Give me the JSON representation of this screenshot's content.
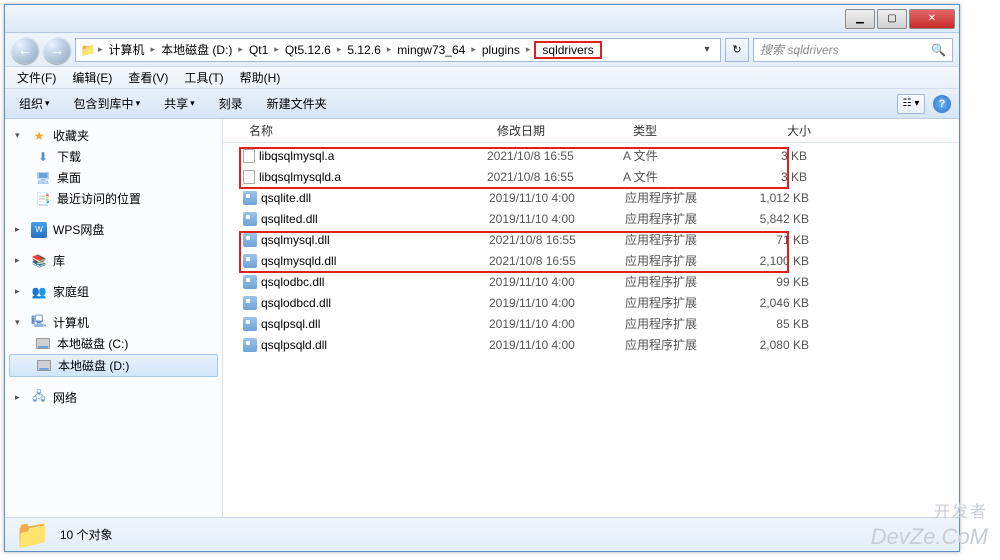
{
  "breadcrumbs": [
    "计算机",
    "本地磁盘 (D:)",
    "Qt1",
    "Qt5.12.6",
    "5.12.6",
    "mingw73_64",
    "plugins",
    "sqldrivers"
  ],
  "search_placeholder": "搜索 sqldrivers",
  "menu": {
    "file": "文件(F)",
    "edit": "编辑(E)",
    "view": "查看(V)",
    "tools": "工具(T)",
    "help": "帮助(H)"
  },
  "toolbar": {
    "organize": "组织",
    "include": "包含到库中",
    "share": "共享",
    "burn": "刻录",
    "newfolder": "新建文件夹"
  },
  "sidebar": {
    "favorites": "收藏夹",
    "downloads": "下载",
    "desktop": "桌面",
    "recent": "最近访问的位置",
    "wps": "WPS网盘",
    "libraries": "库",
    "homegroup": "家庭组",
    "computer": "计算机",
    "drive_c": "本地磁盘 (C:)",
    "drive_d": "本地磁盘 (D:)",
    "network": "网络"
  },
  "columns": {
    "name": "名称",
    "date": "修改日期",
    "type": "类型",
    "size": "大小"
  },
  "files": [
    {
      "name": "libqsqlmysql.a",
      "date": "2021/10/8 16:55",
      "type": "A 文件",
      "size": "3 KB",
      "icon": "file"
    },
    {
      "name": "libqsqlmysqld.a",
      "date": "2021/10/8 16:55",
      "type": "A 文件",
      "size": "3 KB",
      "icon": "file"
    },
    {
      "name": "qsqlite.dll",
      "date": "2019/11/10 4:00",
      "type": "应用程序扩展",
      "size": "1,012 KB",
      "icon": "dll"
    },
    {
      "name": "qsqlited.dll",
      "date": "2019/11/10 4:00",
      "type": "应用程序扩展",
      "size": "5,842 KB",
      "icon": "dll"
    },
    {
      "name": "qsqlmysql.dll",
      "date": "2021/10/8 16:55",
      "type": "应用程序扩展",
      "size": "71 KB",
      "icon": "dll"
    },
    {
      "name": "qsqlmysqld.dll",
      "date": "2021/10/8 16:55",
      "type": "应用程序扩展",
      "size": "2,100 KB",
      "icon": "dll"
    },
    {
      "name": "qsqlodbc.dll",
      "date": "2019/11/10 4:00",
      "type": "应用程序扩展",
      "size": "99 KB",
      "icon": "dll"
    },
    {
      "name": "qsqlodbcd.dll",
      "date": "2019/11/10 4:00",
      "type": "应用程序扩展",
      "size": "2,046 KB",
      "icon": "dll"
    },
    {
      "name": "qsqlpsql.dll",
      "date": "2019/11/10 4:00",
      "type": "应用程序扩展",
      "size": "85 KB",
      "icon": "dll"
    },
    {
      "name": "qsqlpsqld.dll",
      "date": "2019/11/10 4:00",
      "type": "应用程序扩展",
      "size": "2,080 KB",
      "icon": "dll"
    }
  ],
  "status": {
    "count": "10 个对象"
  },
  "watermark_top": "开发者",
  "watermark_bottom": "DevZe.CoM"
}
